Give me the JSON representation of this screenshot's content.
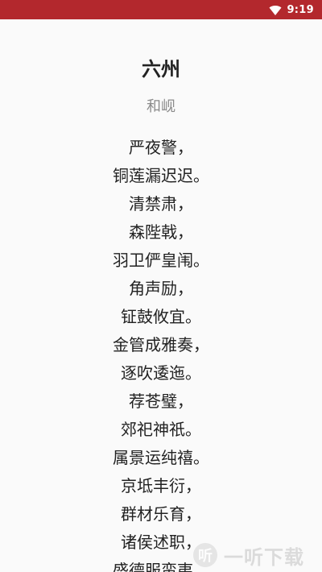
{
  "status_bar": {
    "time": "9:19",
    "wifi_icon": "wifi-icon",
    "background": "#b3282d"
  },
  "poem": {
    "title": "六州",
    "author": "和岘",
    "lines": [
      "严夜警，",
      "铜莲漏迟迟。",
      "清禁肃，",
      "森陛戟，",
      "羽卫俨皇闱。",
      "角声励，",
      "钲鼓攸宜。",
      "金管成雅奏，",
      "逐吹逶迤。",
      "荐苍璧，",
      "郊祀神祇。",
      "属景运纯禧。",
      "京坻丰衍，",
      "群材乐育，",
      "诸侯述职，",
      "盛德服蛮夷。"
    ]
  },
  "watermark": {
    "logo_char": "听",
    "text": "一听下载"
  }
}
